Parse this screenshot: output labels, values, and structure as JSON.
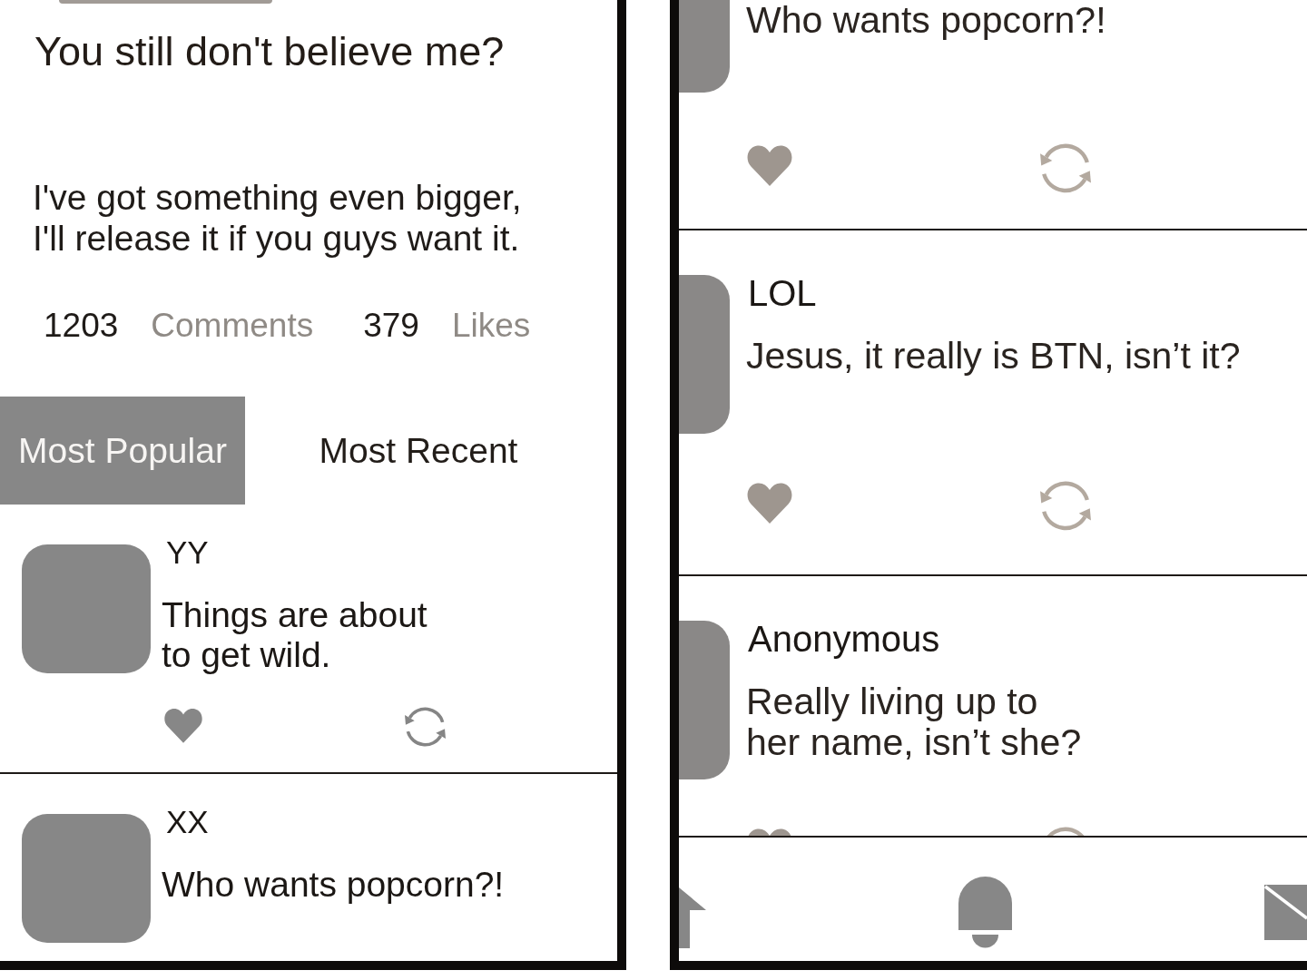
{
  "left_screen": {
    "post": {
      "title": "You still don't believe me?",
      "body": "I've got something even bigger,\nI'll release it if you guys want it.",
      "stats": [
        {
          "count": "1203",
          "label": "Comments"
        },
        {
          "count": "379",
          "label": "Likes"
        }
      ]
    },
    "tabs": [
      {
        "label": "Most Popular",
        "selected": true
      },
      {
        "label": "Most Recent",
        "selected": false
      }
    ],
    "comments": [
      {
        "author": "YY",
        "text": "Things are about\nto get wild."
      },
      {
        "author": "XX",
        "text": "Who wants popcorn?!"
      }
    ]
  },
  "right_screen": {
    "comments": [
      {
        "text": "Who wants popcorn?!"
      },
      {
        "author": "LOL",
        "text": "Jesus, it really is BTN, isn’t it?"
      },
      {
        "author": "Anonymous",
        "text": "Really living up to\nher name, isn’t she?"
      }
    ]
  }
}
